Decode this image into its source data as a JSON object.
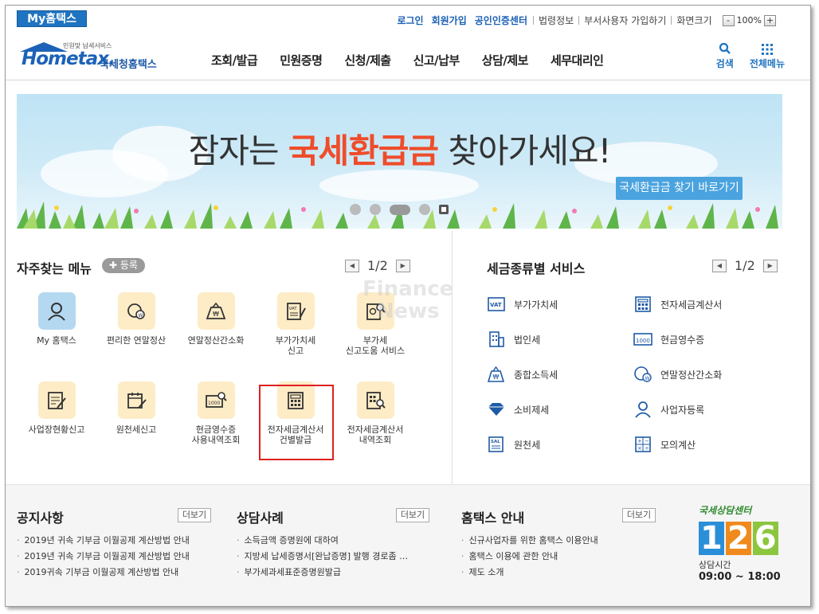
{
  "topbar": {
    "my_hometax": "My홈택스",
    "links_strong": [
      "로그인",
      "회원가입",
      "공인인증센터"
    ],
    "links_plain": [
      "법령정보",
      "부서사용자 가입하기",
      "화면크기"
    ],
    "zoom_minus": "-",
    "zoom_value": "100%",
    "zoom_plus": "+"
  },
  "header": {
    "logo_small": "민원맞 납세서비스",
    "logo_brand": "Hometax.",
    "logo_kor": "국세청홈택스",
    "nav": [
      "조회/발급",
      "민원증명",
      "신청/제출",
      "신고/납부",
      "상담/제보",
      "세무대리인"
    ],
    "search_label": "검색",
    "allmenu_label": "전체메뉴"
  },
  "banner": {
    "title_pre": "잠자는 ",
    "title_highlight": "국세환급금",
    "title_post": " 찾아가세요!",
    "button": "국세환급금 찾기 바로가기"
  },
  "favorites": {
    "title": "자주찾는 메뉴",
    "register": "등록",
    "page": "1/2",
    "items": [
      {
        "label": "My 홈택스"
      },
      {
        "label": "편리한 연말정산"
      },
      {
        "label": "연말정산간소화"
      },
      {
        "label": "부가가치세\n신고"
      },
      {
        "label": "부가세\n신고도움 서비스"
      },
      {
        "label": "사업장현황신고"
      },
      {
        "label": "원천세신고"
      },
      {
        "label": "현금영수증\n사용내역조회"
      },
      {
        "label": "전자세금계산서\n건별발급"
      },
      {
        "label": "전자세금계산서\n내역조회"
      }
    ]
  },
  "watermark": {
    "line1": "Finance",
    "line2": "News"
  },
  "tax_services": {
    "title": "세금종류별 서비스",
    "page": "1/2",
    "left": [
      "부가가치세",
      "법인세",
      "종합소득세",
      "소비제세",
      "원천세"
    ],
    "right": [
      "전자세금계산서",
      "현금영수증",
      "연말정산간소화",
      "사업자등록",
      "모의계산"
    ]
  },
  "footer": {
    "notice": {
      "title": "공지사항",
      "more": "더보기",
      "items": [
        "2019년 귀속 기부금 이월공제 계산방법 안내",
        "2019년 귀속 기부금 이월공제 계산방법 안내",
        "2019귀속 기부금 이월공제 계산방법 안내"
      ]
    },
    "cases": {
      "title": "상담사례",
      "more": "더보기",
      "items": [
        "소득금액 증명원에 대하여",
        "지방세 납세증명서[완납증명] 발행 경로좀 …",
        "부가세과세표준증명원발급"
      ]
    },
    "guide": {
      "title": "홈택스 안내",
      "more": "더보기",
      "items": [
        "신규사업자를 위한 홈택스 이용안내",
        "홈택스 이용에 관한 안내",
        "제도 소개"
      ]
    },
    "callcenter": {
      "title": "국세상담센터",
      "digits": [
        "1",
        "2",
        "6"
      ],
      "digit_colors": [
        "#2a8fd8",
        "#f08a1c",
        "#8cc63e"
      ],
      "time_label": "상담시간",
      "time": "09:00 ~ 18:00"
    }
  }
}
